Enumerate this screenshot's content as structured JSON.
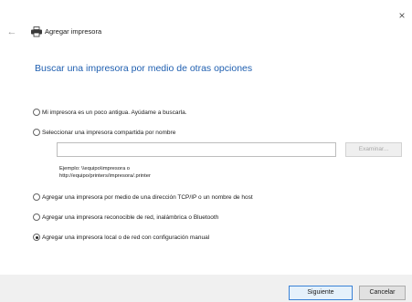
{
  "window": {
    "close_glyph": "×"
  },
  "header": {
    "back_glyph": "←",
    "title": "Agregar impresora"
  },
  "main": {
    "heading": "Buscar una impresora por medio de otras opciones",
    "options": [
      {
        "label": "Mi impresora es un poco antigua. Ayúdame a buscarla.",
        "checked": false
      },
      {
        "label": "Seleccionar una impresora compartida por nombre",
        "checked": false
      },
      {
        "label": "Agregar una impresora por medio de una dirección TCP/IP o un nombre de host",
        "checked": false
      },
      {
        "label": "Agregar una impresora reconocible de red, inalámbrica o Bluetooth",
        "checked": false
      },
      {
        "label": "Agregar una impresora local o de red con configuración manual",
        "checked": true
      }
    ],
    "share_name": {
      "value": "",
      "browse_label": "Examinar..."
    },
    "example": {
      "line1": "Ejemplo: \\\\equipo\\impresora o",
      "line2": "http://equipo/printers/impresora/.printer"
    }
  },
  "footer": {
    "next_label": "Siguiente",
    "cancel_label": "Cancelar"
  },
  "icons": {
    "printer": "printer-icon",
    "back": "back-arrow-icon",
    "close": "close-icon"
  },
  "colors": {
    "heading": "#1f5fb0",
    "footer_bg": "#f0f0f0",
    "primary_border": "#3b82d6"
  }
}
